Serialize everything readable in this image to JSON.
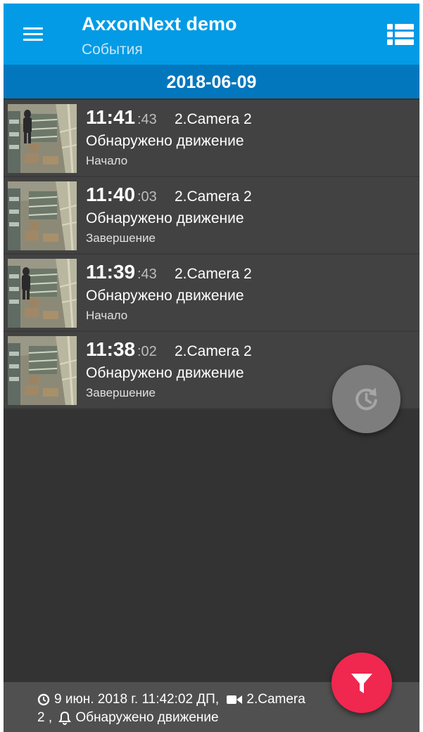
{
  "app": {
    "title": "AxxonNext demo",
    "subtitle": "События"
  },
  "date_header": "2018-06-09",
  "icons": {
    "menu": "menu-icon",
    "view": "list-view-icon",
    "history": "history-icon",
    "filter": "filter-icon",
    "clock": "clock-icon",
    "camera": "video-camera-icon",
    "bell": "bell-icon"
  },
  "colors": {
    "appbar": "#039be5",
    "datebar": "#0277bd",
    "background": "#333333",
    "row": "#424242",
    "history_fab": "#7d7d7d",
    "filter_fab": "#f0274f"
  },
  "events": [
    {
      "hm": "11:41",
      "sec": ":43",
      "camera": "2.Camera 2",
      "type": "Обнаружено движение",
      "phase": "Начало"
    },
    {
      "hm": "11:40",
      "sec": ":03",
      "camera": "2.Camera 2",
      "type": "Обнаружено движение",
      "phase": "Завершение"
    },
    {
      "hm": "11:39",
      "sec": ":43",
      "camera": "2.Camera 2",
      "type": "Обнаружено движение",
      "phase": "Начало"
    },
    {
      "hm": "11:38",
      "sec": ":02",
      "camera": "2.Camera 2",
      "type": "Обнаружено движение",
      "phase": "Завершение"
    }
  ],
  "status": {
    "datetime": "9 июн. 2018 г. 11:42:02 ДП,",
    "camera_part1": "2.Camera",
    "camera_part2": "2 ,",
    "event": "Обнаружено движение"
  }
}
